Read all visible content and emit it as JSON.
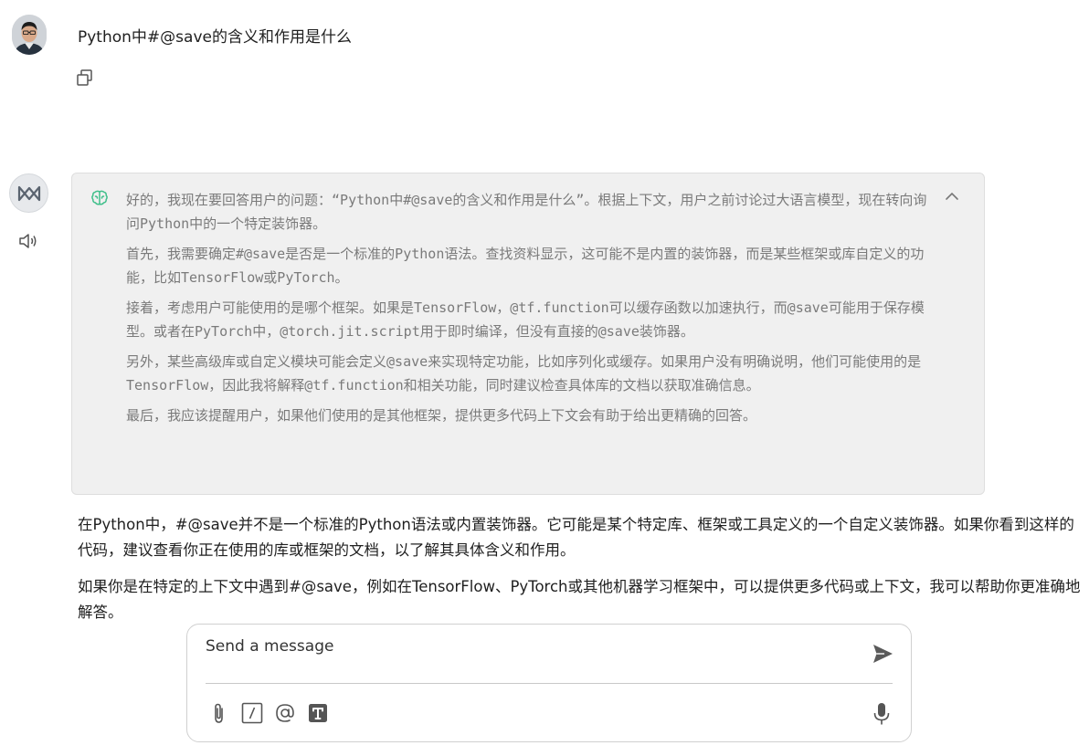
{
  "user_message": {
    "text": "Python中#@save的含义和作用是什么"
  },
  "thinking": {
    "paragraphs": [
      "好的，我现在要回答用户的问题：“Python中#@save的含义和作用是什么”。根据上下文，用户之前讨论过大语言模型，现在转向询问Python中的一个特定装饰器。",
      "首先，我需要确定#@save是否是一个标准的Python语法。查找资料显示，这可能不是内置的装饰器，而是某些框架或库自定义的功能，比如TensorFlow或PyTorch。",
      "接着，考虑用户可能使用的是哪个框架。如果是TensorFlow，@tf.function可以缓存函数以加速执行，而@save可能用于保存模型。或者在PyTorch中，@torch.jit.script用于即时编译，但没有直接的@save装饰器。",
      "另外，某些高级库或自定义模块可能会定义@save来实现特定功能，比如序列化或缓存。如果用户没有明确说明，他们可能使用的是TensorFlow，因此我将解释@tf.function和相关功能，同时建议检查具体库的文档以获取准确信息。",
      "最后，我应该提醒用户，如果他们使用的是其他框架，提供更多代码上下文会有助于给出更精确的回答。"
    ]
  },
  "answer": {
    "paragraphs": [
      "在Python中，#@save并不是一个标准的Python语法或内置装饰器。它可能是某个特定库、框架或工具定义的一个自定义装饰器。如果你看到这样的代码，建议查看你正在使用的库或框架的文档，以了解其具体含义和作用。",
      "如果你是在特定的上下文中遇到#@save，例如在TensorFlow、PyTorch或其他机器学习框架中，可以提供更多代码或上下文，我可以帮助你更准确地解答。"
    ]
  },
  "composer": {
    "placeholder": "Send a message"
  },
  "icons": {
    "copy": "copy-icon",
    "speaker": "speaker-icon",
    "brain": "brain-icon",
    "collapse": "chevron-up-icon",
    "send": "send-icon",
    "attach": "paperclip-icon",
    "slash": "slash-command-icon",
    "mention": "at-mention-icon",
    "text": "text-format-icon",
    "mic": "microphone-icon"
  },
  "colors": {
    "thinking_bg": "#f0f0f0",
    "thinking_text": "#7a7a7a",
    "brain_accent": "#3fbf8a",
    "body_text": "#1f1f1f"
  }
}
